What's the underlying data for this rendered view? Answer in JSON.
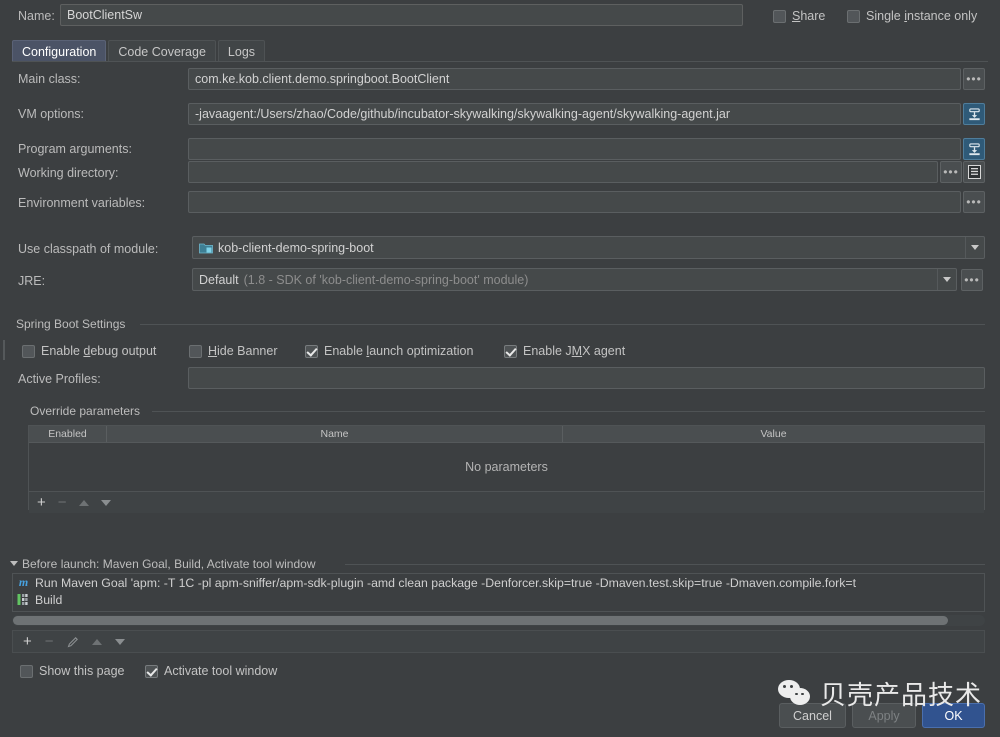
{
  "window": {
    "name_label": "Name:",
    "name_value": "BootClientSw",
    "share_label": "Share",
    "share_mnemonic": "S",
    "single_instance_label": "Single instance only",
    "single_instance_mnemonic": "i",
    "share_checked": false,
    "single_instance_checked": false
  },
  "tabs": [
    {
      "label": "Configuration",
      "active": true
    },
    {
      "label": "Code Coverage",
      "active": false
    },
    {
      "label": "Logs",
      "active": false
    }
  ],
  "form": {
    "main_class": {
      "label": "Main class:",
      "value": "com.ke.kob.client.demo.springboot.BootClient",
      "button": "browse-dots"
    },
    "vm_options": {
      "label": "VM options:",
      "value": "-javaagent:/Users/zhao/Code/github/incubator-skywalking/skywalking-agent/skywalking-agent.jar",
      "button": "expand-insert"
    },
    "program_arguments": {
      "label": "Program arguments:",
      "value": "",
      "button": "expand-insert"
    },
    "working_directory": {
      "label": "Working directory:",
      "value": "",
      "buttons": [
        "browse-dots",
        "macro-list"
      ]
    },
    "environment_variables": {
      "label": "Environment variables:",
      "value": "",
      "button": "browse-dots"
    },
    "use_classpath_of_module": {
      "label": "Use classpath of module:",
      "value": "kob-client-demo-spring-boot"
    },
    "jre": {
      "label": "JRE:",
      "value": "Default",
      "value_detail": "(1.8 - SDK of 'kob-client-demo-spring-boot' module)",
      "button": "browse-dots"
    }
  },
  "spring_boot_settings": {
    "title": "Spring Boot Settings",
    "checkboxes": [
      {
        "label": "Enable debug output",
        "mnemonic": "d",
        "checked": false
      },
      {
        "label": "Hide Banner",
        "mnemonic": "H",
        "checked": false
      },
      {
        "label": "Enable launch optimization",
        "mnemonic": "l",
        "checked": true
      },
      {
        "label": "Enable JMX agent",
        "mnemonic": "M",
        "checked": true
      }
    ],
    "active_profiles": {
      "label": "Active Profiles:",
      "value": ""
    }
  },
  "override_parameters": {
    "title": "Override parameters",
    "columns": [
      "Enabled",
      "Name",
      "Value"
    ],
    "empty_text": "No parameters",
    "toolbar": [
      "add",
      "remove",
      "move-up",
      "move-down"
    ]
  },
  "before_launch": {
    "title": "Before launch: Maven Goal, Build, Activate tool window",
    "tasks": [
      {
        "icon": "maven-icon",
        "label": "Run Maven Goal 'apm: -T 1C -pl apm-sniffer/apm-sdk-plugin -amd clean package -Denforcer.skip=true -Dmaven.test.skip=true -Dmaven.compile.fork=t"
      },
      {
        "icon": "build-icon",
        "label": "Build"
      }
    ],
    "toolbar": [
      "add",
      "remove",
      "edit",
      "move-up",
      "move-down"
    ],
    "show_this_page": {
      "label": "Show this page",
      "checked": false
    },
    "activate_tool_window": {
      "label": "Activate tool window",
      "checked": true
    }
  },
  "buttons": {
    "cancel": "Cancel",
    "apply": "Apply",
    "ok": "OK"
  },
  "watermark": {
    "text": "贝壳产品技术",
    "logo": "wechat-icon"
  },
  "colors": {
    "background": "#3c3f41",
    "field": "#45494a",
    "accent": "#31538f",
    "tab_active": "#4b5366",
    "maven_icon": "#47a2e0"
  }
}
